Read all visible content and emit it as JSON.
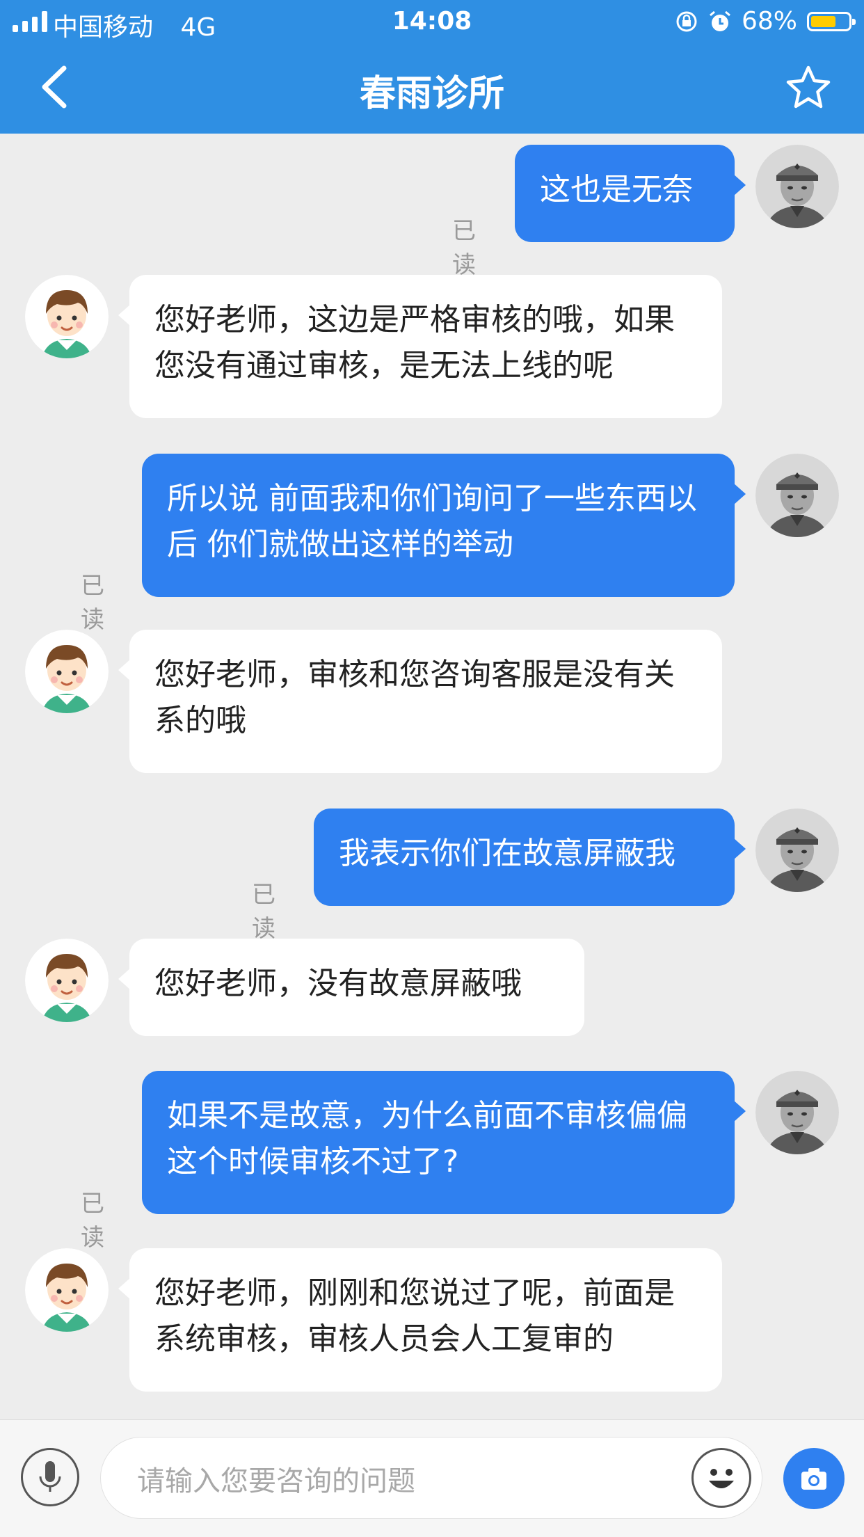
{
  "status_bar": {
    "carrier": "中国移动",
    "network": "4G",
    "time": "14:08",
    "battery": "68%"
  },
  "header": {
    "title": "春雨诊所"
  },
  "messages": [
    {
      "from": "me",
      "text": "这也是无奈",
      "status": "已读"
    },
    {
      "from": "clinic",
      "text": "您好老师，这边是严格审核的哦，如果您没有通过审核，是无法上线的呢"
    },
    {
      "from": "me",
      "text": "所以说 前面我和你们询问了一些东西以后 你们就做出这样的举动",
      "status": "已读"
    },
    {
      "from": "clinic",
      "text": "您好老师，审核和您咨询客服是没有关系的哦"
    },
    {
      "from": "me",
      "text": "我表示你们在故意屏蔽我",
      "status": "已读"
    },
    {
      "from": "clinic",
      "text": "您好老师，没有故意屏蔽哦"
    },
    {
      "from": "me",
      "text": "如果不是故意，为什么前面不审核偏偏这个时候审核不过了?",
      "status": "已读"
    },
    {
      "from": "clinic",
      "text": "您好老师，刚刚和您说过了呢，前面是系统审核，审核人员会人工复审的"
    }
  ],
  "input": {
    "placeholder": "请输入您要咨询的问题"
  },
  "icons": [
    "back-arrow-icon",
    "star-icon",
    "microphone-icon",
    "emoji-icon",
    "camera-icon"
  ],
  "colors": {
    "primary": "#2f8fe3",
    "bubble_out": "#2f80f0",
    "background": "#ededed"
  }
}
